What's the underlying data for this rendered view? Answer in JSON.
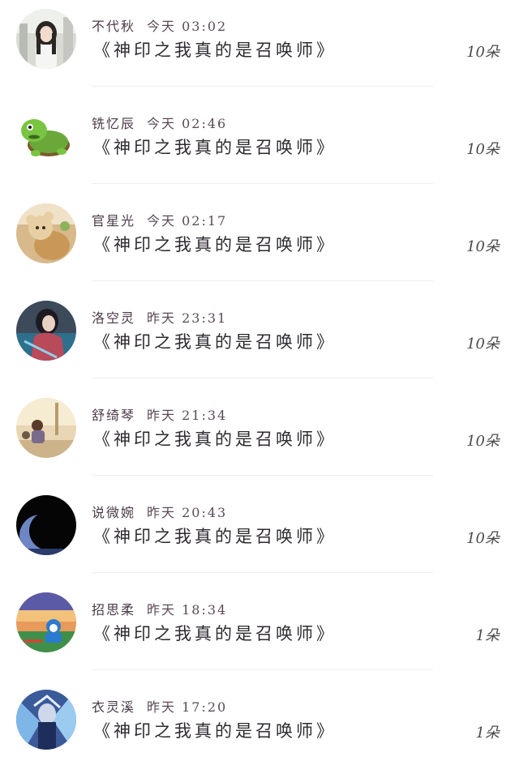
{
  "items": [
    {
      "name": "不代秋",
      "time": "今天 03:02",
      "book": "《神印之我真的是召唤师》",
      "gift": "10朵",
      "avatar": "avatar-girl-in-street"
    },
    {
      "name": "铣忆辰",
      "time": "今天 02:46",
      "book": "《神印之我真的是召唤师》",
      "gift": "10朵",
      "avatar": "avatar-green-turtle"
    },
    {
      "name": "官星光",
      "time": "今天 02:17",
      "book": "《神印之我真的是召唤师》",
      "gift": "10朵",
      "avatar": "avatar-teddy-bear"
    },
    {
      "name": "洛空灵",
      "time": "昨天 23:31",
      "book": "《神印之我真的是召唤师》",
      "gift": "10朵",
      "avatar": "avatar-fantasy-girl"
    },
    {
      "name": "舒绮琴",
      "time": "昨天 21:34",
      "book": "《神印之我真的是召唤师》",
      "gift": "10朵",
      "avatar": "avatar-sitting-figure"
    },
    {
      "name": "说微婉",
      "time": "昨天 20:43",
      "book": "《神印之我真的是召唤师》",
      "gift": "10朵",
      "avatar": "avatar-moon-silhouette"
    },
    {
      "name": "招思柔",
      "time": "昨天 18:34",
      "book": "《神印之我真的是召唤师》",
      "gift": "1朵",
      "avatar": "avatar-sunset-doraemon"
    },
    {
      "name": "衣灵溪",
      "time": "昨天 17:20",
      "book": "《神印之我真的是召唤师》",
      "gift": "1朵",
      "avatar": "avatar-blue-anime"
    }
  ]
}
